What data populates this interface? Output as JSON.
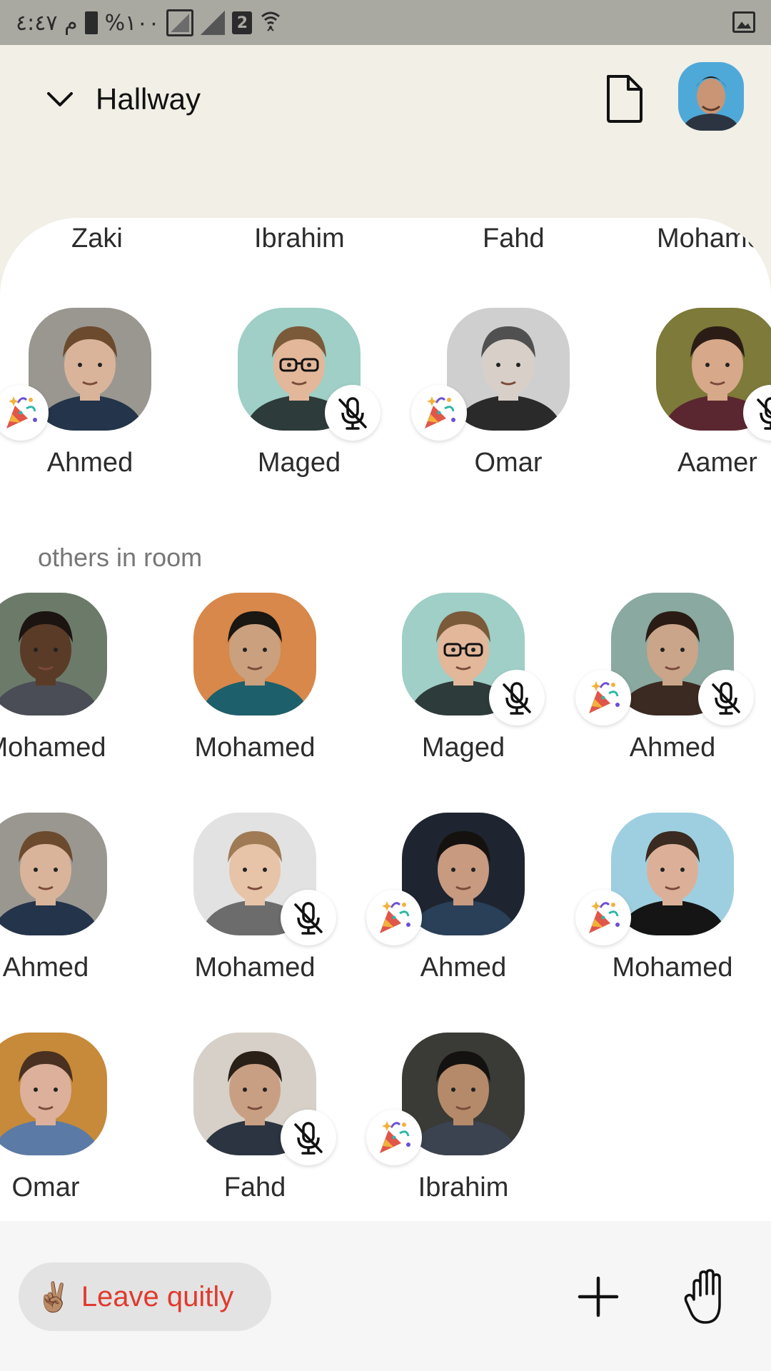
{
  "status_bar": {
    "time_text": "م ٤:٤٧",
    "battery_text": "%١٠٠",
    "sim_badge": "2"
  },
  "header": {
    "room_name": "Hallway",
    "icons": [
      "chevron-down-icon",
      "document-icon",
      "profile-avatar"
    ]
  },
  "stage_partial_names": [
    "Zaki",
    "Ibrahim",
    "Fahd",
    "Mohame"
  ],
  "stage": [
    {
      "name": "Ahmed",
      "badge": "party",
      "bg": "#9a9790",
      "skin": "#d9b49a",
      "hair": "#6b4a2e",
      "shirt": "#24344a"
    },
    {
      "name": "Maged",
      "badge": "mute",
      "bg": "#9fcfc6",
      "skin": "#e3b79a",
      "hair": "#7b5a3a",
      "shirt": "#2d3b3a",
      "glasses": true
    },
    {
      "name": "Omar",
      "badge": "party",
      "bg": "#cfcfcf",
      "skin": "#d8d0c8",
      "hair": "#505050",
      "shirt": "#2a2a2a"
    },
    {
      "name": "Aamer",
      "badge": "mute",
      "bg": "#7d7a3a",
      "skin": "#d7a88a",
      "hair": "#2b1d16",
      "shirt": "#5a2730"
    }
  ],
  "others_label": "others in room",
  "others": [
    {
      "name": "Mohamed",
      "badge": "none",
      "bg": "#6c7a6a",
      "skin": "#5a3b28",
      "hair": "#1b1410",
      "shirt": "#4a4d55"
    },
    {
      "name": "Mohamed",
      "badge": "none",
      "bg": "#d7884a",
      "skin": "#caa07f",
      "hair": "#1a1612",
      "shirt": "#1d5f6b"
    },
    {
      "name": "Maged",
      "badge": "mute",
      "bg": "#9fcfc6",
      "skin": "#e3b79a",
      "hair": "#7b5a3a",
      "shirt": "#2d3b3a",
      "glasses": true
    },
    {
      "name": "Ahmed",
      "badge": "both",
      "bg": "#8aa9a0",
      "skin": "#caa58a",
      "hair": "#2a1c14",
      "shirt": "#3a2a22"
    },
    {
      "name": "Ahmed",
      "badge": "none",
      "bg": "#9a9790",
      "skin": "#d9b49a",
      "hair": "#6b4a2e",
      "shirt": "#24344a"
    },
    {
      "name": "Mohamed",
      "badge": "mute",
      "bg": "#e2e2e2",
      "skin": "#e7c3a8",
      "hair": "#a07a55",
      "shirt": "#6c6c6c"
    },
    {
      "name": "Ahmed",
      "badge": "party",
      "bg": "#1e2530",
      "skin": "#c89a80",
      "hair": "#15110f",
      "shirt": "#2a3f58"
    },
    {
      "name": "Mohamed",
      "badge": "party",
      "bg": "#9ecfe0",
      "skin": "#dcb098",
      "hair": "#3a2a20",
      "shirt": "#151515"
    },
    {
      "name": "Omar",
      "badge": "none",
      "bg": "#c68a3a",
      "skin": "#dcb09a",
      "hair": "#4a3020",
      "shirt": "#5b7aa6"
    },
    {
      "name": "Fahd",
      "badge": "mute",
      "bg": "#d6d0c8",
      "skin": "#c99f83",
      "hair": "#2a2018",
      "shirt": "#2b3440"
    },
    {
      "name": "Ibrahim",
      "badge": "party",
      "bg": "#3a3a36",
      "skin": "#b58a6a",
      "hair": "#141210",
      "shirt": "#3b4250"
    }
  ],
  "footer": {
    "leave_emoji": "✌🏽",
    "leave_label": "Leave quitly",
    "icons": [
      "plus-icon",
      "raise-hand-icon"
    ]
  },
  "colors": {
    "header_bg": "#f1efe6",
    "leave_text": "#e03a2e",
    "leave_bg": "#e3e3e3"
  }
}
